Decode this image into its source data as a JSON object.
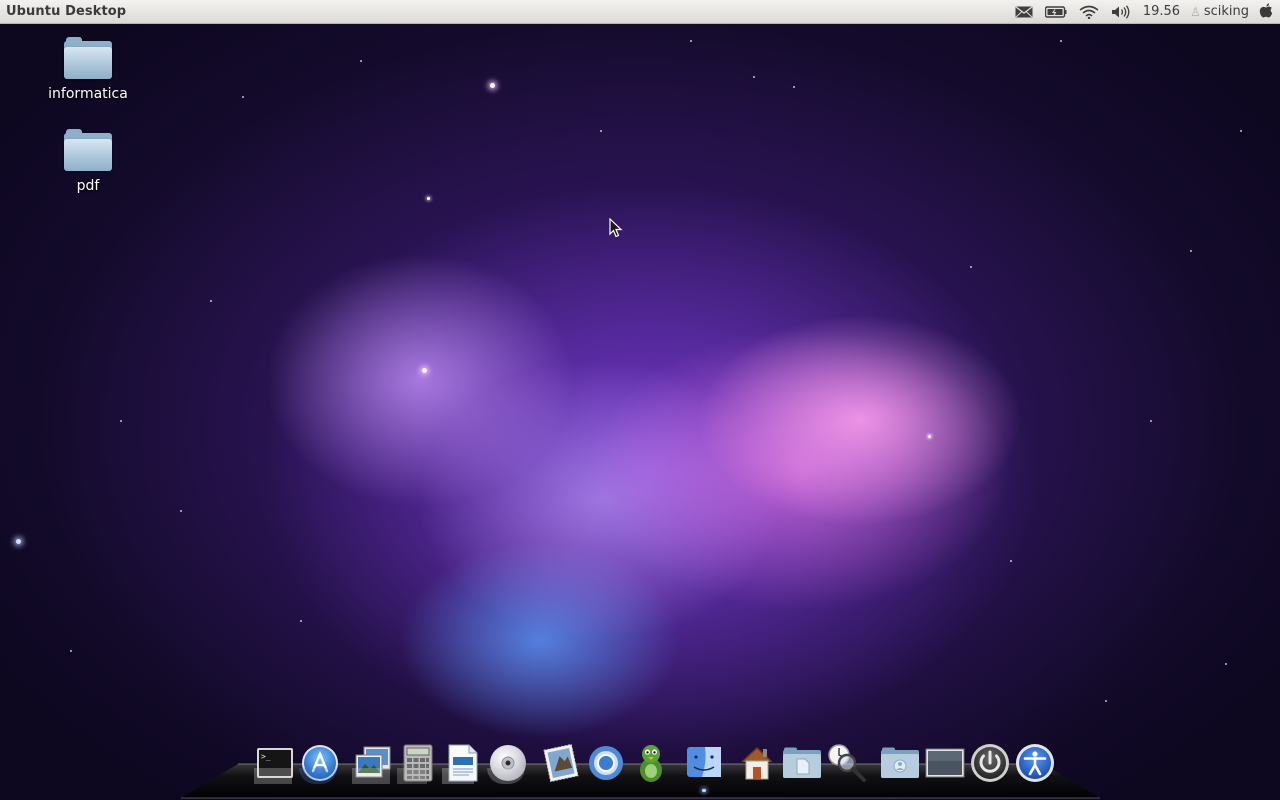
{
  "top_panel": {
    "app_title": "Ubuntu Desktop",
    "clock": "19.56",
    "user": "sciking",
    "indicators": [
      "mail-icon",
      "battery-icon",
      "wifi-icon",
      "volume-icon",
      "apple-icon"
    ]
  },
  "desktop": {
    "icons": [
      {
        "label": "informatica",
        "icon": "folder-icon"
      },
      {
        "label": "pdf",
        "icon": "folder-icon"
      }
    ]
  },
  "dock": {
    "items": [
      "terminal-icon",
      "app-store-icon",
      "image-viewer-icon",
      "calculator-icon",
      "text-document-icon",
      "dvd-icon",
      "mail-stamp-icon",
      "chromium-icon",
      "pidgin-icon",
      "finder-icon",
      "home-icon",
      "documents-folder-icon",
      "clock-search-icon",
      "user-folder-icon",
      "screen-icon",
      "power-icon",
      "accessibility-icon"
    ]
  },
  "colors": {
    "panel_bg": "#dcdad5",
    "panel_text": "#3c3c3c",
    "wallpaper_dark": "#120a26",
    "nebula_pink": "#f3a0f0",
    "nebula_blue": "#5aa0ff"
  }
}
